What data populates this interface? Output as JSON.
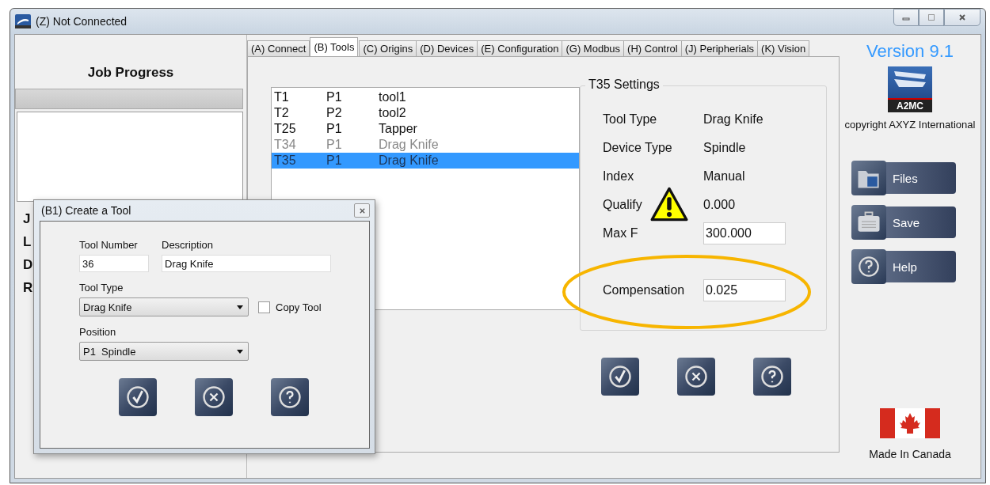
{
  "window": {
    "title": "(Z) Not Connected"
  },
  "left_panel": {
    "title": "Job Progress",
    "progress": {
      "level": 0
    },
    "labels": [
      "J",
      "L",
      "D",
      "R"
    ]
  },
  "tabs": [
    {
      "label": "(A) Connect",
      "selected": false
    },
    {
      "label": "(B) Tools",
      "selected": true
    },
    {
      "label": "(C) Origins",
      "selected": false
    },
    {
      "label": "(D) Devices",
      "selected": false
    },
    {
      "label": "(E) Configuration",
      "selected": false
    },
    {
      "label": "(G) Modbus",
      "selected": false
    },
    {
      "label": "(H) Control",
      "selected": false
    },
    {
      "label": "(J) Peripherials",
      "selected": false
    },
    {
      "label": "(K) Vision",
      "selected": false
    }
  ],
  "tool_list": [
    {
      "number": "T1",
      "position": "P1",
      "description": "tool1",
      "dimmed": false,
      "selected": false
    },
    {
      "number": "T2",
      "position": "P2",
      "description": "tool2",
      "dimmed": false,
      "selected": false
    },
    {
      "number": "T25",
      "position": "P1",
      "description": "Tapper",
      "dimmed": false,
      "selected": false
    },
    {
      "number": "T34",
      "position": "P1",
      "description": "Drag Knife",
      "dimmed": true,
      "selected": false
    },
    {
      "number": "T35",
      "position": "P1",
      "description": "Drag Knife",
      "dimmed": true,
      "selected": true
    }
  ],
  "settings": {
    "title": "T35 Settings",
    "rows": [
      {
        "label": "Tool Type",
        "value": "Drag Knife",
        "kind": "text"
      },
      {
        "label": "Device Type",
        "value": "Spindle",
        "kind": "text"
      },
      {
        "label": "Index",
        "value": "Manual",
        "kind": "text"
      },
      {
        "label": "Qualify",
        "value": "0.000",
        "kind": "warning"
      },
      {
        "label": "Max F",
        "value": "300.000",
        "kind": "field"
      },
      {
        "label": "Compensation",
        "value": "0.025",
        "kind": "field",
        "highlighted": true
      }
    ]
  },
  "action_buttons": [
    {
      "kind": "ok"
    },
    {
      "kind": "cancel"
    },
    {
      "kind": "help"
    }
  ],
  "dialog": {
    "title": "(B1) Create a Tool",
    "tool_number": {
      "label": "Tool Number",
      "value": "36"
    },
    "description": {
      "label": "Description",
      "value": "Drag Knife"
    },
    "tool_type": {
      "label": "Tool Type",
      "value": "Drag Knife"
    },
    "copy_tool": {
      "label": "Copy Tool",
      "checked": false
    },
    "position": {
      "label": "Position",
      "value": "P1  Spindle"
    },
    "buttons": [
      {
        "kind": "ok"
      },
      {
        "kind": "cancel"
      },
      {
        "kind": "help"
      }
    ]
  },
  "sidebar": {
    "version": "Version 9.1",
    "logo": "A2MC",
    "copyright": "copyright AXYZ International",
    "buttons": [
      {
        "label": "Files",
        "kind": "files"
      },
      {
        "label": "Save",
        "kind": "save"
      },
      {
        "label": "Help",
        "kind": "help"
      }
    ],
    "made_in": "Made In Canada"
  }
}
